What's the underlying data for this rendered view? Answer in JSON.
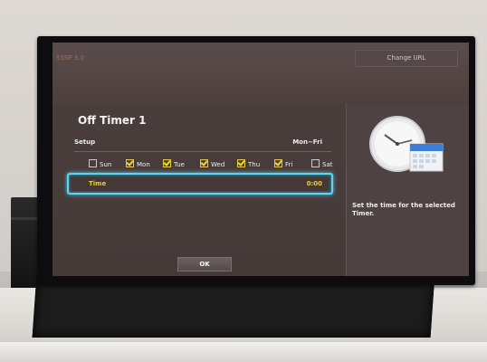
{
  "app": {
    "title": "SSSP 3.0",
    "change_url_label": "Change URL"
  },
  "dialog": {
    "title": "Off Timer 1",
    "setup_label": "Setup",
    "setup_value": "Mon~Fri",
    "days": [
      {
        "label": "Sun",
        "checked": false
      },
      {
        "label": "Mon",
        "checked": true
      },
      {
        "label": "Tue",
        "checked": true
      },
      {
        "label": "Wed",
        "checked": true
      },
      {
        "label": "Thu",
        "checked": true
      },
      {
        "label": "Fri",
        "checked": true
      },
      {
        "label": "Sat",
        "checked": false
      }
    ],
    "time_label": "Time",
    "time_value": "0:00",
    "ok_label": "OK"
  },
  "help": {
    "text": "Set the time for the selected Timer.",
    "icon": "clock-calendar-icon"
  },
  "colors": {
    "focus_accent": "#5cd6f0",
    "highlight_text": "#e9c94b",
    "checkbox_check": "#f2d547",
    "app_title": "#b76a48"
  }
}
